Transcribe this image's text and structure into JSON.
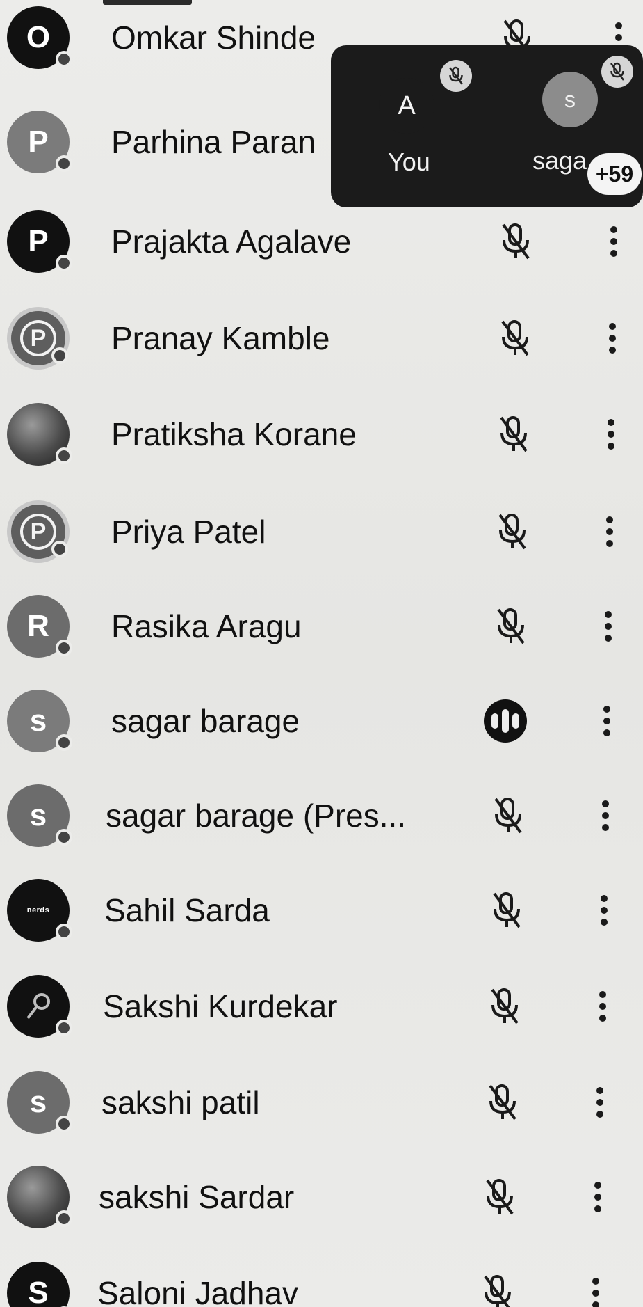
{
  "participants": [
    {
      "name": "Omkar Shinde",
      "initial": "O",
      "mic": "muted"
    },
    {
      "name": "Parhina Paran",
      "initial": "P",
      "mic": "muted"
    },
    {
      "name": "Prajakta Agalave",
      "initial": "P",
      "mic": "muted"
    },
    {
      "name": "Pranay Kamble",
      "initial": "P",
      "mic": "muted"
    },
    {
      "name": "Pratiksha Korane",
      "initial": "",
      "mic": "muted"
    },
    {
      "name": "Priya Patel",
      "initial": "P",
      "mic": "muted"
    },
    {
      "name": "Rasika Aragu",
      "initial": "R",
      "mic": "muted"
    },
    {
      "name": "sagar barage",
      "initial": "s",
      "mic": "speaking"
    },
    {
      "name": "sagar barage (Pres...",
      "initial": "s",
      "mic": "muted"
    },
    {
      "name": "Sahil Sarda",
      "initial": "nerds",
      "mic": "muted"
    },
    {
      "name": "Sakshi Kurdekar",
      "initial": "",
      "mic": "muted"
    },
    {
      "name": "sakshi patil",
      "initial": "s",
      "mic": "muted"
    },
    {
      "name": "sakshi Sardar",
      "initial": "",
      "mic": "muted"
    },
    {
      "name": "Saloni Jadhav",
      "initial": "S",
      "mic": "muted"
    }
  ],
  "pip": {
    "self_initial": "A",
    "self_label": "You",
    "other_initial": "s",
    "other_label": "saga",
    "overflow_count": "+59"
  },
  "icons": {
    "mic": "mic-off-icon",
    "speaking": "audio-level-icon",
    "more": "more-vert-icon"
  }
}
